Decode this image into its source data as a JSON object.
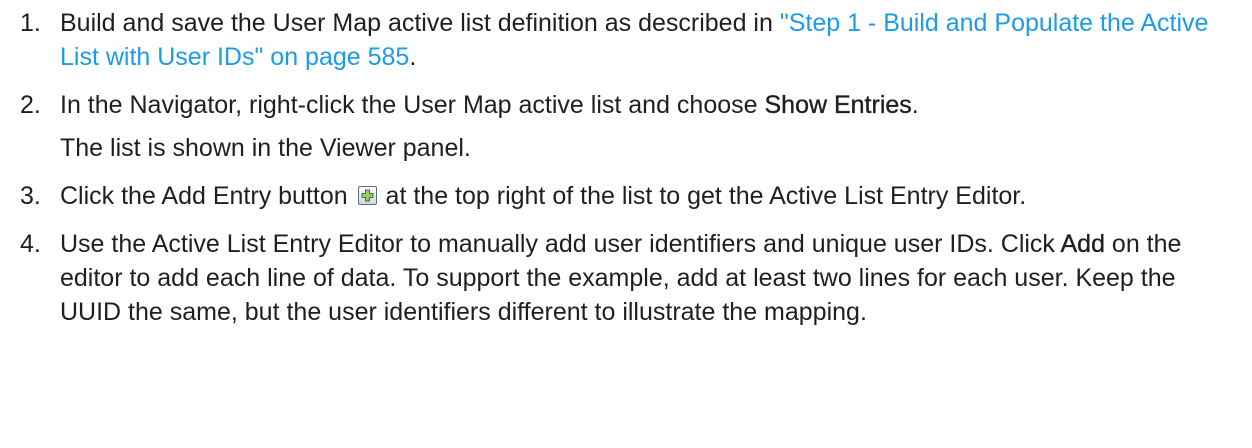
{
  "steps": [
    {
      "number": "1.",
      "text_before": "Build and save the User Map active list definition as described in ",
      "link": "\"Step 1 - Build and Populate the Active List with User IDs\" on page 585",
      "text_after": "."
    },
    {
      "number": "2.",
      "text_before": "In the Navigator, right-click the User Map active list and choose ",
      "bold": "Show Entries",
      "text_after": ".",
      "subtext": "The list is shown in the Viewer panel."
    },
    {
      "number": "3.",
      "text_before": "Click the Add Entry button ",
      "icon": "add-entry-icon",
      "text_after": " at the top right of the list to get the Active List Entry Editor."
    },
    {
      "number": "4.",
      "text_before": "Use the Active List Entry Editor to manually add user identifiers and unique user IDs. Click ",
      "bold": "Add",
      "text_after": " on the editor to add each line of data. To support the example, add at least two lines for each user. Keep the UUID the same, but the user identifiers different to illustrate the mapping."
    }
  ],
  "colors": {
    "text": "#1f1f1f",
    "link": "#1e9be6"
  }
}
